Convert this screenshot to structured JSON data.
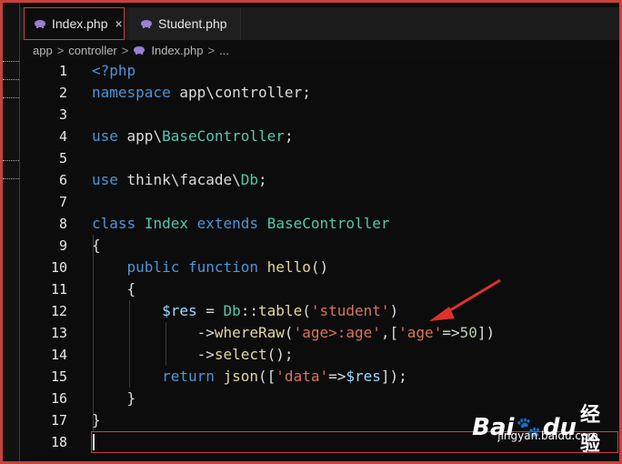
{
  "tabs": [
    {
      "label": "Index.php",
      "active": true,
      "close": "×"
    },
    {
      "label": "Student.php",
      "active": false
    }
  ],
  "breadcrumb": {
    "items": [
      "app",
      "controller",
      "Index.php",
      "..."
    ],
    "separator": ">"
  },
  "editor": {
    "lines": [
      {
        "num": "1",
        "text": "<?php"
      },
      {
        "num": "2",
        "text": "namespace app\\controller;"
      },
      {
        "num": "3",
        "text": ""
      },
      {
        "num": "4",
        "text": "use app\\BaseController;"
      },
      {
        "num": "5",
        "text": ""
      },
      {
        "num": "6",
        "text": "use think\\facade\\Db;"
      },
      {
        "num": "7",
        "text": ""
      },
      {
        "num": "8",
        "text": "class Index extends BaseController"
      },
      {
        "num": "9",
        "text": "{"
      },
      {
        "num": "10",
        "text": "    public function hello()"
      },
      {
        "num": "11",
        "text": "    {"
      },
      {
        "num": "12",
        "text": "        $res = Db::table('student')"
      },
      {
        "num": "13",
        "text": "            ->whereRaw('age>:age',['age'=>50])"
      },
      {
        "num": "14",
        "text": "            ->select();"
      },
      {
        "num": "15",
        "text": "        return json(['data'=>$res]);"
      },
      {
        "num": "16",
        "text": "    }"
      },
      {
        "num": "17",
        "text": "}"
      },
      {
        "num": "18",
        "text": ""
      }
    ]
  },
  "watermark": {
    "brand_latin": "Bai",
    "brand_latin2": "du",
    "brand_cn": "经验",
    "url": "jingyan.baidu.com"
  },
  "colors": {
    "highlight_red": "#c8423c",
    "keyword": "#4d95d8",
    "class": "#4ec9b0",
    "string": "#d6755d"
  }
}
